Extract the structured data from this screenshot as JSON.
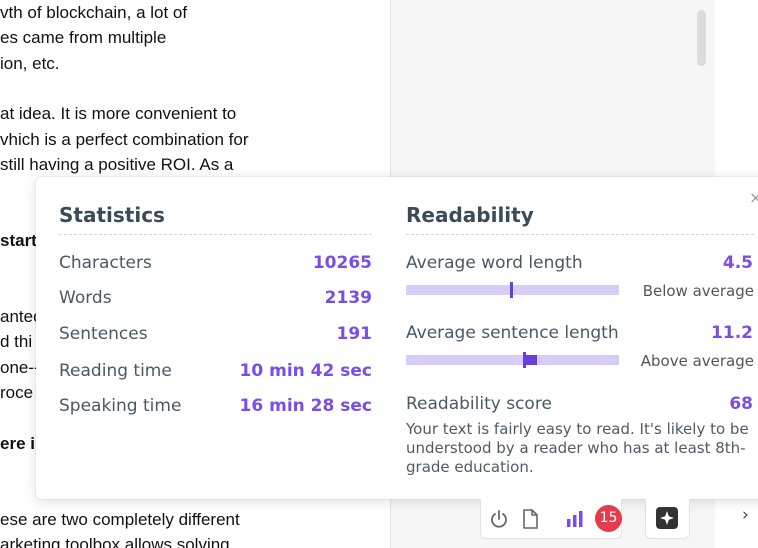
{
  "document": {
    "lines": [
      {
        "text": "vth of blockchain, a lot of",
        "bold": false
      },
      {
        "text": "es came from multiple",
        "bold": false
      },
      {
        "text": "ion, etc.",
        "bold": false
      },
      {
        "text": "at idea. It is more convenient to",
        "bold": false
      },
      {
        "text": "vhich is a perfect combination for",
        "bold": false
      },
      {
        "text": "still having a positive ROI. As a",
        "bold": false
      },
      {
        "text": "startu",
        "bold": true
      },
      {
        "text": "antec",
        "bold": false
      },
      {
        "text": "d thi",
        "bold": false
      },
      {
        "text": "one--",
        "bold": false
      },
      {
        "text": "roce",
        "bold": false
      },
      {
        "text": "ere i",
        "bold": true
      },
      {
        "text": "ese are two completely different",
        "bold": false
      },
      {
        "text": "arketing toolbox allows solving",
        "bold": false
      }
    ]
  },
  "popup": {
    "close_glyph": "×",
    "statistics": {
      "title": "Statistics",
      "rows": [
        {
          "label": "Characters",
          "value": "10265"
        },
        {
          "label": "Words",
          "value": "2139"
        },
        {
          "label": "Sentences",
          "value": "191"
        },
        {
          "label": "Reading time",
          "value": "10 min 42 sec"
        },
        {
          "label": "Speaking time",
          "value": "16 min 28 sec"
        }
      ]
    },
    "readability": {
      "title": "Readability",
      "word_length": {
        "label": "Average word length",
        "value": "4.5",
        "hint": "Below average",
        "level": 0.49
      },
      "sentence_length": {
        "label": "Average sentence length",
        "value": "11.2",
        "hint": "Above average",
        "level": 0.55
      },
      "score": {
        "label": "Readability score",
        "value": "68"
      },
      "description": "Your text is fairly easy to read. It's likely to be understood by a reader who has at least 8th-grade education."
    }
  },
  "toolbar": {
    "power_icon": "power-icon",
    "document_icon": "document-icon",
    "stats_icon": "bar-chart-icon",
    "issue_count": "15",
    "chevron_glyph": "›"
  },
  "colors": {
    "accent": "#7a4ee6",
    "track": "#d7cdf9",
    "badge": "#e53b4d"
  }
}
